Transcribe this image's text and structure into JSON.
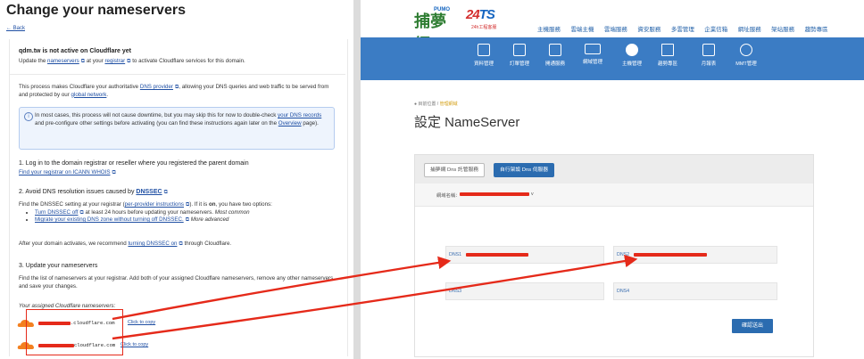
{
  "left": {
    "title": "Change your nameservers",
    "back": "← Back",
    "status_title": "qdm.tw is not active on Cloudflare yet",
    "status_sub_1": "Update the",
    "status_sub_link1": "nameservers",
    "status_sub_2": "at your",
    "status_sub_link2": "registrar",
    "status_sub_3": "to activate Cloudflare services for this domain.",
    "intro_1": "This process makes Cloudflare your authoritative",
    "intro_link1": "DNS provider",
    "intro_2": ", allowing your DNS queries and web traffic to be served from and protected by our",
    "intro_link2": "global network",
    "intro_3": ".",
    "info_1": "In most cases, this process will not cause downtime, but you may skip this for now to double-check",
    "info_link1": "your DNS records",
    "info_2": "and pre-configure other settings before activating (you can find these instructions again later on the",
    "info_link2": "Overview",
    "info_3": "page).",
    "step1_title": "1. Log in to the domain registrar or reseller where you registered the parent domain",
    "step1_link": "Find your registrar on ICANN WHOIS",
    "step2_title": "2. Avoid DNS resolution issues caused by",
    "step2_title_link": "DNSSEC",
    "step2_text_1": "Find the DNSSEC setting at your registrar (",
    "step2_text_link": "per-provider instructions",
    "step2_text_2": "). If it is",
    "step2_text_on": "on",
    "step2_text_3": ", you have two options:",
    "step2_opt1_link": "Turn DNSSEC off",
    "step2_opt1_text": "at least 24 hours before updating your nameservers.",
    "step2_opt1_em": "Most common",
    "step2_opt2_link": "Migrate your existing DNS zone without turning off DNSSEC.",
    "step2_opt2_em": "More advanced",
    "step2_after_1": "After your domain activates, we recommend",
    "step2_after_link": "turning DNSSEC on",
    "step2_after_2": "through Cloudflare.",
    "step3_title": "3. Update your nameservers",
    "step3_text": "Find the list of nameservers at your registrar. Add both of your assigned Cloudflare nameservers, remove any other nameservers, and save your changes.",
    "assigned_label": "Your assigned Cloudflare nameservers:",
    "ns1_suffix": ".cloudflare.com",
    "ns2_suffix": "cloudflare.com",
    "copy_label": "Click to copy"
  },
  "right": {
    "logo_text": "捕夢網",
    "logo_small": "PUMO",
    "logo_247": "24",
    "logo_247_ts": "TS",
    "logo_247_sub": "24h工程客服",
    "topnav": [
      "主機服務",
      "雲端主機",
      "雲端服務",
      "資安服務",
      "多雲管理",
      "企業信箱",
      "網址服務",
      "架站服務",
      "趨勢專區"
    ],
    "navbar": [
      "資料管理",
      "訂單管理",
      "開通服務",
      "網域管理",
      "主機管理",
      "趨勢專區",
      "月報表",
      "MMT管理"
    ],
    "breadcrumb_home": "目前位置 /",
    "breadcrumb_current": "管理網域",
    "page_title": "設定 NameServer",
    "tab1": "捕夢網 Dns 託管服務",
    "tab2": "自行架設 Dns 伺服器",
    "domain_label": "網域名稱：",
    "domain_suffix": "v",
    "dns1": "DNS1",
    "dns2": "DNS2",
    "dns3": "DNS3",
    "dns4": "DNS4",
    "confirm": "確認送出"
  },
  "colors": {
    "accent_blue": "#3b7cc4",
    "annotation_red": "#e52a1a",
    "cloudflare_orange": "#f38020"
  }
}
